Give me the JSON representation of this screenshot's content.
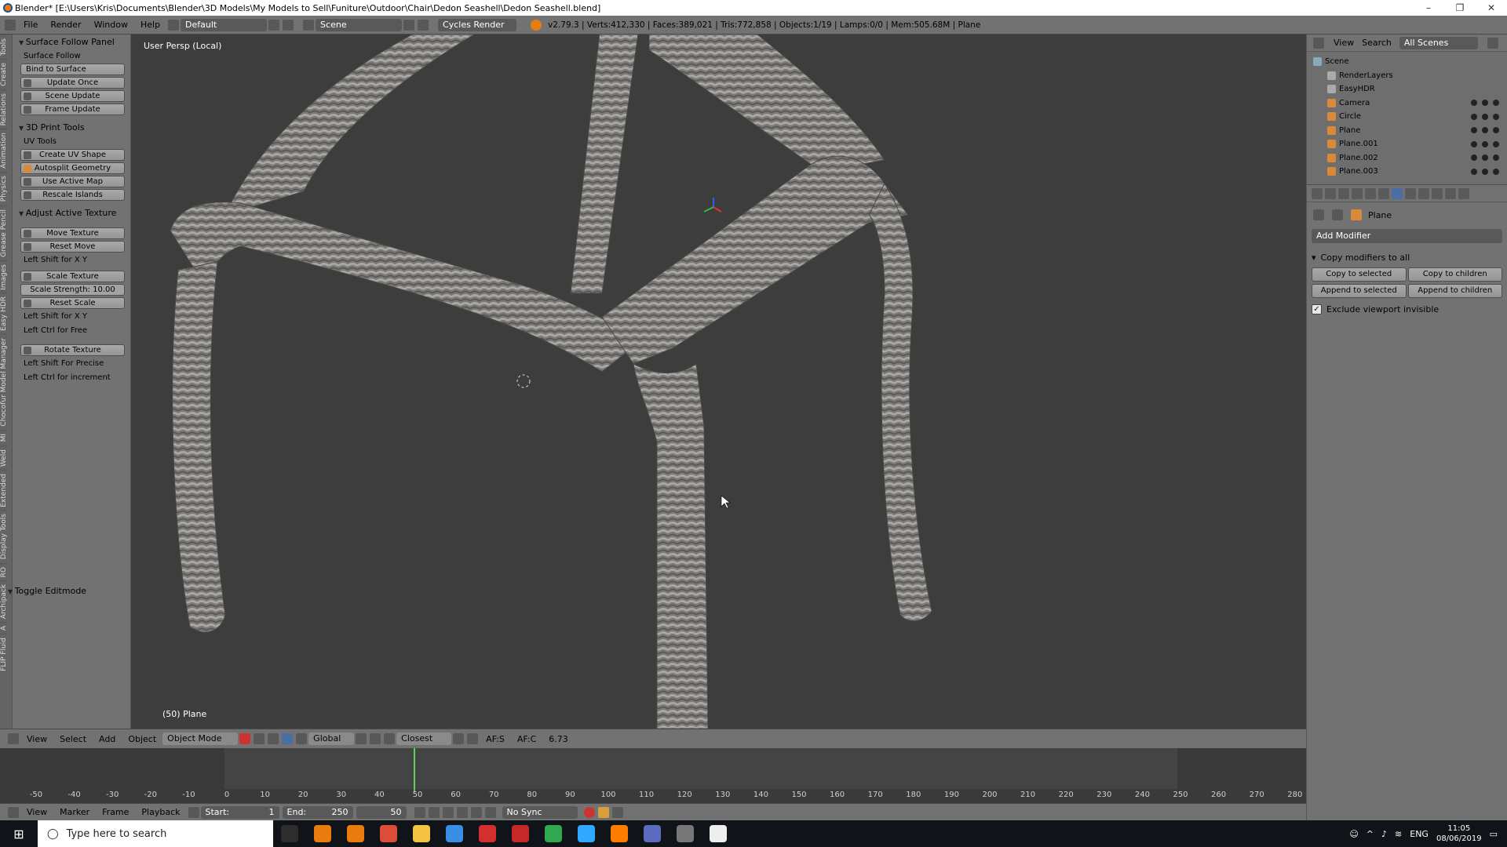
{
  "window": {
    "title": "Blender* [E:\\Users\\Kris\\Documents\\Blender\\3D Models\\My Models to Sell\\Funiture\\Outdoor\\Chair\\Dedon Seashell\\Dedon Seashell.blend]",
    "minimize": "–",
    "maximize": "❐",
    "close": "✕"
  },
  "menubar": {
    "items": [
      "File",
      "Render",
      "Window",
      "Help"
    ],
    "layout": "Default",
    "scene": "Scene",
    "engine": "Cycles Render",
    "stats": "v2.79.3 | Verts:412,330 | Faces:389,021 | Tris:772,858 | Objects:1/19 | Lamps:0/0 | Mem:505.68M | Plane"
  },
  "vtabs": [
    "Tools",
    "Create",
    "Relations",
    "Animation",
    "Physics",
    "Grease Pencil",
    "Images",
    "Easy HDR",
    "Chocofur Model Manager",
    "MI",
    "Weld",
    "Extended",
    "Display Tools",
    "RO",
    "Archipack",
    "A",
    "FLIP Fluid"
  ],
  "tools": {
    "surface_follow": {
      "header": "Surface Follow Panel",
      "label": "Surface Follow",
      "bind": "Bind to Surface",
      "once": "Update Once",
      "scene": "Scene Update",
      "frame": "Frame Update"
    },
    "print3d": {
      "header": "3D Print Tools",
      "uv_label": "UV Tools",
      "create": "Create UV Shape",
      "autosplit": "Autosplit Geometry",
      "active": "Use Active Map",
      "rescale": "Rescale Islands"
    },
    "adjust": {
      "header": "Adjust Active Texture",
      "move": "Move Texture",
      "reset_move": "Reset Move",
      "hint1": "Left Shift for X Y",
      "scale": "Scale Texture",
      "strength_label": "Scale Strength:",
      "strength": "10.00",
      "reset_scale": "Reset Scale",
      "hint2": "Left Shift for X Y",
      "hint3": "Left Ctrl for Free",
      "rotate": "Rotate Texture",
      "hint4": "Left Shift For Precise",
      "hint5": "Left Ctrl for increment"
    },
    "toggle": "Toggle Editmode"
  },
  "viewport": {
    "title": "User Persp (Local)",
    "object": "(50) Plane"
  },
  "header3d": {
    "items": [
      "View",
      "Select",
      "Add",
      "Object"
    ],
    "mode": "Object Mode",
    "orientation": "Global",
    "snap": "Closest",
    "afs": "AF:S",
    "afc": "AF:C",
    "value": "6.73"
  },
  "timeline": {
    "ticks": [
      "-50",
      "-40",
      "-30",
      "-20",
      "-10",
      "0",
      "10",
      "20",
      "30",
      "40",
      "50",
      "60",
      "70",
      "80",
      "90",
      "100",
      "110",
      "120",
      "130",
      "140",
      "150",
      "160",
      "170",
      "180",
      "190",
      "200",
      "210",
      "220",
      "230",
      "240",
      "250",
      "260",
      "270",
      "280"
    ],
    "items": [
      "View",
      "Marker",
      "Frame",
      "Playback"
    ],
    "start_label": "Start:",
    "start": "1",
    "end_label": "End:",
    "end": "250",
    "current": "50",
    "sync": "No Sync"
  },
  "outliner": {
    "menu": [
      "View",
      "Search"
    ],
    "filter": "All Scenes",
    "rows": [
      {
        "name": "Scene",
        "icon": "#8ab"
      },
      {
        "name": "RenderLayers",
        "icon": "#aaa"
      },
      {
        "name": "EasyHDR",
        "icon": "#aaa"
      },
      {
        "name": "Camera",
        "icon": "#d8893a"
      },
      {
        "name": "Circle",
        "icon": "#d8893a"
      },
      {
        "name": "Plane",
        "icon": "#d8893a"
      },
      {
        "name": "Plane.001",
        "icon": "#d8893a"
      },
      {
        "name": "Plane.002",
        "icon": "#d8893a"
      },
      {
        "name": "Plane.003",
        "icon": "#d8893a"
      }
    ]
  },
  "properties": {
    "object": "Plane",
    "add_modifier": "Add Modifier",
    "copy_header": "Copy modifiers to all",
    "copy_sel": "Copy to selected",
    "copy_child": "Copy to children",
    "append_sel": "Append to selected",
    "append_child": "Append to children",
    "exclude": "Exclude viewport invisible"
  },
  "taskbar": {
    "search": "Type here to search",
    "lang": "ENG",
    "time": "11:05",
    "date": "08/06/2019",
    "apps": [
      "#2d2d2d",
      "#e87d0d",
      "#e87d0d",
      "#dd4b39",
      "#f5c342",
      "#3a8ee6",
      "#d32f2f",
      "#c62828",
      "#2fa84f",
      "#31a8ff",
      "#ff7c00",
      "#5c6bc0",
      "#777",
      "#eee"
    ]
  },
  "colors": {
    "accent": "#e87d0d",
    "cursor_frame": "#5dd35b",
    "viewport_bg": "#3d3d3d",
    "panel": "#727272"
  }
}
